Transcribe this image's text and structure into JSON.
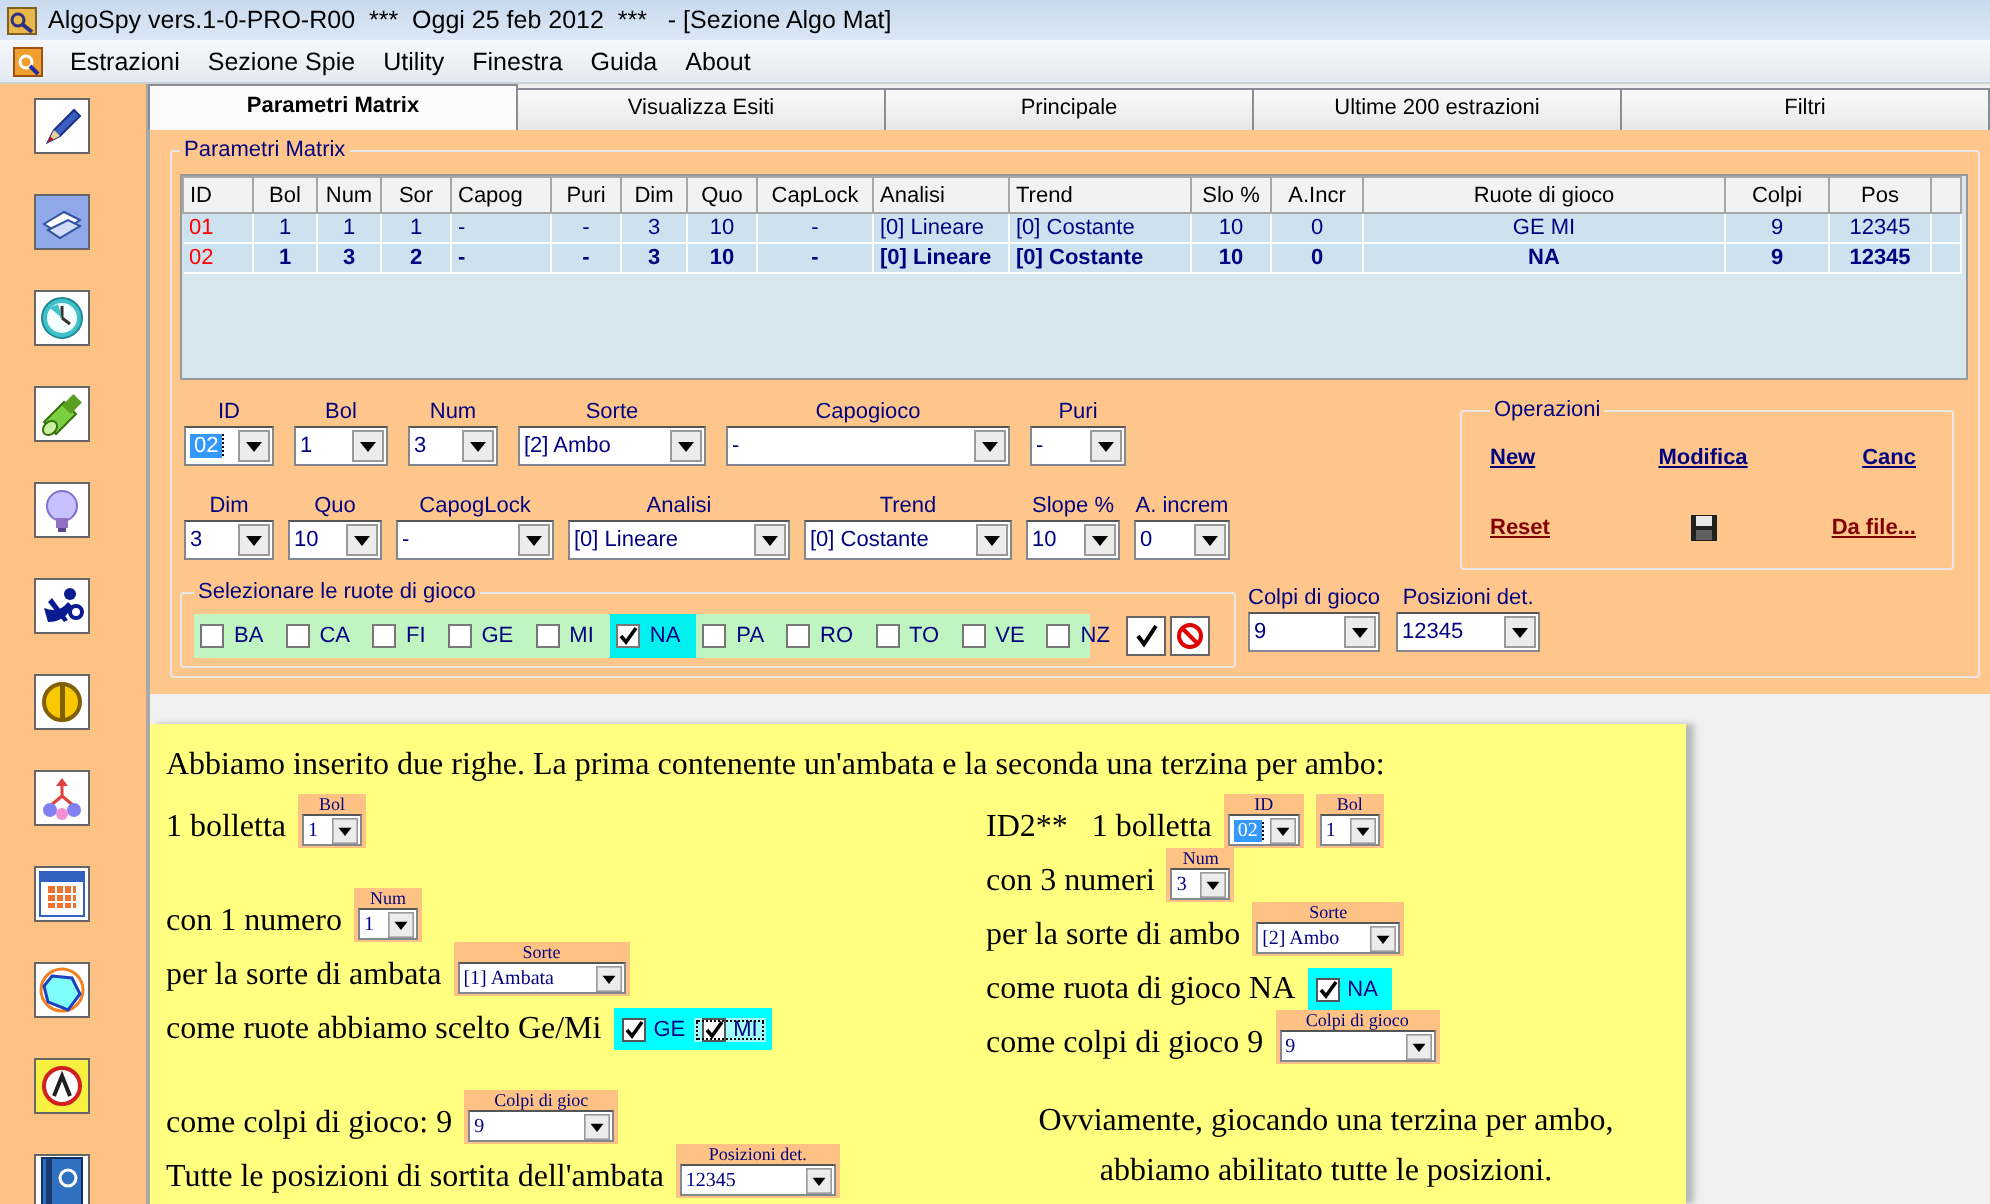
{
  "window": {
    "title": "AlgoSpy vers.1-0-PRO-R00  ***  Oggi 25 feb 2012  ***   - [Sezione Algo Mat]"
  },
  "menu": [
    "Estrazioni",
    "Sezione Spie",
    "Utility",
    "Finestra",
    "Guida",
    "About"
  ],
  "tabs": [
    {
      "label": "Parametri Matrix",
      "selected": true
    },
    {
      "label": "Visualizza Esiti",
      "selected": false
    },
    {
      "label": "Principale",
      "selected": false
    },
    {
      "label": "Ultime 200 estrazioni",
      "selected": false
    },
    {
      "label": "Filtri",
      "selected": false
    }
  ],
  "matrix": {
    "title": "Parametri Matrix",
    "columns": [
      "ID",
      "Bol",
      "Num",
      "Sor",
      "Capog",
      "Puri",
      "Dim",
      "Quo",
      "CapLock",
      "Analisi",
      "Trend",
      "Slo %",
      "A.Incr",
      "Ruote di gioco",
      "Colpi",
      "Pos"
    ],
    "rows": [
      {
        "selected": false,
        "cells": [
          "01",
          "1",
          "1",
          "1",
          "-",
          "-",
          "3",
          "10",
          "-",
          "[0] Lineare",
          "[0] Costante",
          "10",
          "0",
          "GE MI",
          "9",
          "12345"
        ]
      },
      {
        "selected": true,
        "cells": [
          "02",
          "1",
          "3",
          "2",
          "-",
          "-",
          "3",
          "10",
          "-",
          "[0] Lineare",
          "[0] Costante",
          "10",
          "0",
          "NA",
          "9",
          "12345"
        ]
      }
    ]
  },
  "fields": [
    [
      {
        "label": "ID",
        "value": "02",
        "focused": true
      },
      {
        "label": "Bol",
        "value": "1",
        "focused": false
      },
      {
        "label": "Num",
        "value": "3",
        "focused": false
      },
      {
        "label": "Sorte",
        "value": "[2] Ambo",
        "focused": false
      },
      {
        "label": "Capogioco",
        "value": "-",
        "focused": false
      },
      {
        "label": "Puri",
        "value": "-",
        "focused": false
      }
    ],
    [
      {
        "label": "Dim",
        "value": "3",
        "focused": false
      },
      {
        "label": "Quo",
        "value": "10",
        "focused": false
      },
      {
        "label": "CapogLock",
        "value": "-",
        "focused": false
      },
      {
        "label": "Analisi",
        "value": "[0] Lineare",
        "focused": false
      },
      {
        "label": "Trend",
        "value": "[0] Costante",
        "focused": false
      },
      {
        "label": "Slope %",
        "value": "10",
        "focused": false
      },
      {
        "label": "A. increm",
        "value": "0",
        "focused": false
      }
    ]
  ],
  "wheels": {
    "title": "Selezionare le ruote di gioco",
    "items": [
      {
        "label": "BA",
        "checked": false
      },
      {
        "label": "CA",
        "checked": false
      },
      {
        "label": "FI",
        "checked": false
      },
      {
        "label": "GE",
        "checked": false
      },
      {
        "label": "MI",
        "checked": false
      },
      {
        "label": "NA",
        "checked": true
      },
      {
        "label": "PA",
        "checked": false
      },
      {
        "label": "RO",
        "checked": false
      },
      {
        "label": "TO",
        "checked": false
      },
      {
        "label": "VE",
        "checked": false
      },
      {
        "label": "NZ",
        "checked": false
      }
    ]
  },
  "colpi": {
    "label": "Colpi di gioco",
    "value": "9"
  },
  "posizioni": {
    "label": "Posizioni det.",
    "value": "12345"
  },
  "operations": {
    "title": "Operazioni",
    "actions": [
      {
        "kind": "link",
        "label": "New",
        "color": "#000080"
      },
      {
        "kind": "link",
        "label": "Modifica",
        "color": "#000080"
      },
      {
        "kind": "link",
        "label": "Canc",
        "color": "#000080"
      },
      {
        "kind": "link",
        "label": "Reset",
        "color": "#800000"
      },
      {
        "kind": "save"
      },
      {
        "kind": "link",
        "label": "Da file...",
        "color": "#800000"
      }
    ]
  },
  "note": {
    "heading": "Abbiamo inserito due righe. La prima contenente un'ambata e la seconda una terzina per ambo:",
    "left": [
      {
        "text": "1 bolletta",
        "widgets": [
          {
            "kind": "combo",
            "label": "Bol",
            "value": "1",
            "focused": false
          }
        ]
      },
      {
        "text": "con 1 numero",
        "widgets": [
          {
            "kind": "combo",
            "label": "Num",
            "value": "1",
            "focused": false
          }
        ]
      },
      {
        "text": "per la sorte di ambata",
        "widgets": [
          {
            "kind": "combo",
            "label": "Sorte",
            "value": "[1] Ambata",
            "focused": false
          }
        ]
      },
      {
        "text": "come ruote abbiamo scelto Ge/Mi",
        "widgets": [
          {
            "kind": "checks",
            "items": [
              {
                "label": "GE",
                "checked": true,
                "focused": false
              },
              {
                "label": "MI",
                "checked": true,
                "focused": true
              }
            ]
          }
        ]
      },
      {
        "text": "come colpi di gioco: 9",
        "widgets": [
          {
            "kind": "combo",
            "label": "Colpi di gioc",
            "value": "9",
            "focused": false
          }
        ]
      },
      {
        "text": "Tutte le posizioni di sortita dell'ambata",
        "widgets": [
          {
            "kind": "combo",
            "label": "Posizioni det.",
            "value": "12345",
            "focused": false
          }
        ]
      }
    ],
    "right": [
      {
        "text": "ID2**   1 bolletta",
        "widgets": [
          {
            "kind": "combo",
            "label": "ID",
            "value": "02",
            "focused": true
          },
          {
            "kind": "combo",
            "label": "Bol",
            "value": "1",
            "focused": false
          }
        ]
      },
      {
        "text": "con 3 numeri",
        "widgets": [
          {
            "kind": "combo",
            "label": "Num",
            "value": "3",
            "focused": false
          }
        ]
      },
      {
        "text": "per la sorte di ambo",
        "widgets": [
          {
            "kind": "combo",
            "label": "Sorte",
            "value": "[2] Ambo",
            "focused": false
          }
        ]
      },
      {
        "text": "come ruota di gioco NA",
        "widgets": [
          {
            "kind": "checks",
            "items": [
              {
                "label": "NA",
                "checked": true,
                "focused": false
              }
            ]
          }
        ]
      },
      {
        "text": "come colpi di gioco 9",
        "widgets": [
          {
            "kind": "combo",
            "label": "Colpi di gioco",
            "value": "9",
            "focused": false
          }
        ]
      }
    ],
    "closing": "Ovviamente, giocando una terzina per ambo, abbiamo abilitato tutte le posizioni."
  }
}
